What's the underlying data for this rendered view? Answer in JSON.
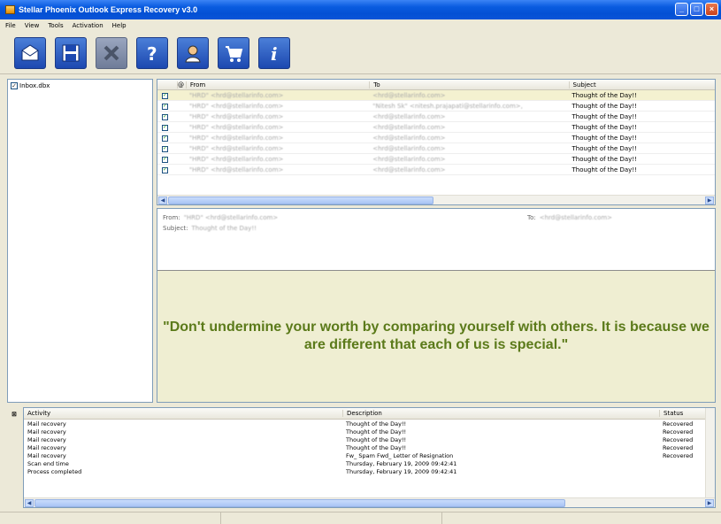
{
  "window": {
    "title": "Stellar Phoenix Outlook Express Recovery v3.0"
  },
  "menu": [
    "File",
    "View",
    "Tools",
    "Activation",
    "Help"
  ],
  "toolbar": [
    {
      "name": "open-icon",
      "disabled": false
    },
    {
      "name": "save-icon",
      "disabled": false
    },
    {
      "name": "stop-icon",
      "disabled": true
    },
    {
      "name": "help-icon",
      "disabled": false
    },
    {
      "name": "support-icon",
      "disabled": false
    },
    {
      "name": "buy-icon",
      "disabled": false
    },
    {
      "name": "info-icon",
      "disabled": false
    }
  ],
  "folders": [
    {
      "label": "Inbox.dbx",
      "checked": true
    }
  ],
  "message_list": {
    "columns": {
      "from": "From",
      "to": "To",
      "subject": "Subject"
    },
    "rows": [
      {
        "from": "\"HRD\" <hrd@stellarinfo.com>",
        "to": "<hrd@stellarinfo.com>",
        "subject": "Thought of the Day!!",
        "selected": true
      },
      {
        "from": "\"HRD\" <hrd@stellarinfo.com>",
        "to": "\"Nitesh Sk\" <nitesh.prajapati@stellarinfo.com>,",
        "subject": "Thought of the Day!!",
        "selected": false
      },
      {
        "from": "\"HRD\" <hrd@stellarinfo.com>",
        "to": "<hrd@stellarinfo.com>",
        "subject": "Thought of the Day!!",
        "selected": false
      },
      {
        "from": "\"HRD\" <hrd@stellarinfo.com>",
        "to": "<hrd@stellarinfo.com>",
        "subject": "Thought of the Day!!",
        "selected": false
      },
      {
        "from": "\"HRD\" <hrd@stellarinfo.com>",
        "to": "<hrd@stellarinfo.com>",
        "subject": "Thought of the Day!!",
        "selected": false
      },
      {
        "from": "\"HRD\" <hrd@stellarinfo.com>",
        "to": "<hrd@stellarinfo.com>",
        "subject": "Thought of the Day!!",
        "selected": false
      },
      {
        "from": "\"HRD\" <hrd@stellarinfo.com>",
        "to": "<hrd@stellarinfo.com>",
        "subject": "Thought of the Day!!",
        "selected": false
      },
      {
        "from": "\"HRD\" <hrd@stellarinfo.com>",
        "to": "<hrd@stellarinfo.com>",
        "subject": "Thought of the Day!!",
        "selected": false
      }
    ]
  },
  "preview": {
    "from_label": "From:",
    "from_value": "\"HRD\" <hrd@stellarinfo.com>",
    "to_label": "To:",
    "to_value": "<hrd@stellarinfo.com>",
    "subject_label": "Subject:",
    "subject_value": "Thought of the Day!!",
    "quote": "\"Don't undermine your worth by comparing yourself with others. It is because we are different that each of us is special.\""
  },
  "log": {
    "columns": {
      "activity": "Activity",
      "description": "Description",
      "status": "Status"
    },
    "rows": [
      {
        "activity": "Mail recovery",
        "description": "Thought of the Day!!",
        "status": "Recovered"
      },
      {
        "activity": "Mail recovery",
        "description": "Thought of the Day!!",
        "status": "Recovered"
      },
      {
        "activity": "Mail recovery",
        "description": "Thought of the Day!!",
        "status": "Recovered"
      },
      {
        "activity": "Mail recovery",
        "description": "Thought of the Day!!",
        "status": "Recovered"
      },
      {
        "activity": "Mail recovery",
        "description": "Fw_ Spam Fwd_ Letter of Resignation",
        "status": "Recovered"
      },
      {
        "activity": "Scan end time",
        "description": "Thursday, February 19, 2009 09:42:41",
        "status": ""
      },
      {
        "activity": "Process completed",
        "description": "Thursday, February 19, 2009 09:42:41",
        "status": ""
      }
    ]
  }
}
